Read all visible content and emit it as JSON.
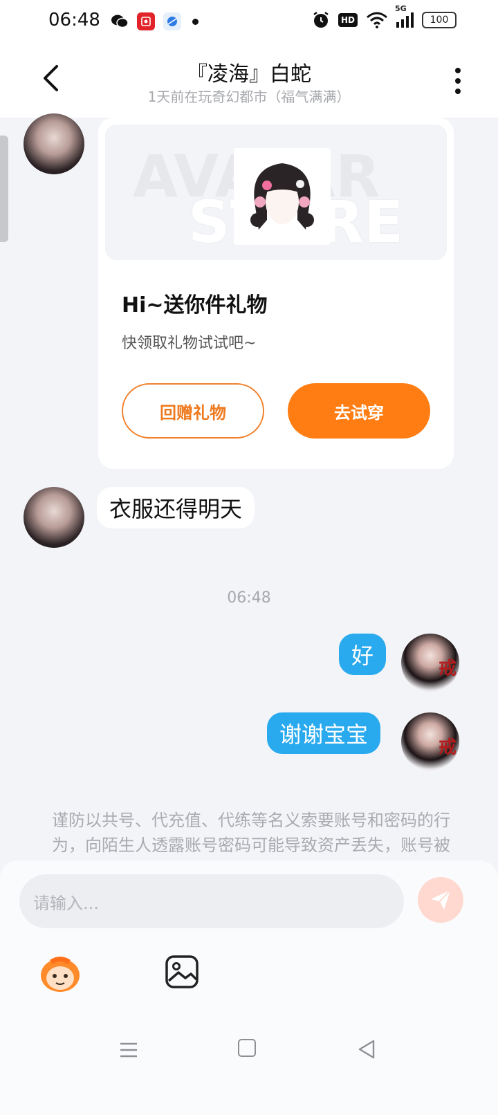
{
  "status_bar": {
    "time": "06:48",
    "battery": "100",
    "hd": "HD",
    "network": "5G"
  },
  "header": {
    "title": "『凌海』白蛇",
    "subtitle": "1天前在玩奇幻都市（福气满满）"
  },
  "gift_card": {
    "banner_text": [
      "AVATAR",
      "STORE"
    ],
    "title": "Hi~送你件礼物",
    "description": "快领取礼物试试吧~",
    "return_gift_label": "回赠礼物",
    "try_on_label": "去试穿"
  },
  "messages": [
    {
      "side": "in",
      "text": "衣服还得明天"
    },
    {
      "side": "out",
      "text": "好"
    },
    {
      "side": "out",
      "text": "谢谢宝宝"
    }
  ],
  "time_separator": "06:48",
  "warning": "谨防以共号、代充值、代练等名义索要账号和密码的行为，向陌生人透露账号密码可能导致资产丢失，账号被盗",
  "input": {
    "placeholder": "请输入..."
  },
  "colors": {
    "accent_orange": "#ff7d12",
    "bubble_blue": "#29a9ee",
    "background": "#f2f4f8"
  }
}
